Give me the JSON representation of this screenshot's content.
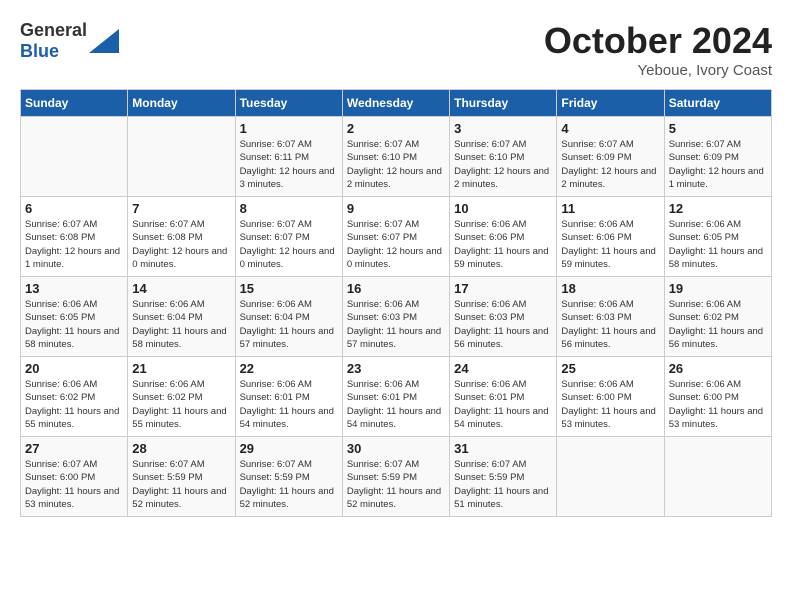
{
  "header": {
    "logo_general": "General",
    "logo_blue": "Blue",
    "month": "October 2024",
    "location": "Yeboue, Ivory Coast"
  },
  "weekdays": [
    "Sunday",
    "Monday",
    "Tuesday",
    "Wednesday",
    "Thursday",
    "Friday",
    "Saturday"
  ],
  "weeks": [
    [
      {
        "day": "",
        "content": ""
      },
      {
        "day": "",
        "content": ""
      },
      {
        "day": "1",
        "content": "Sunrise: 6:07 AM\nSunset: 6:11 PM\nDaylight: 12 hours and 3 minutes."
      },
      {
        "day": "2",
        "content": "Sunrise: 6:07 AM\nSunset: 6:10 PM\nDaylight: 12 hours and 2 minutes."
      },
      {
        "day": "3",
        "content": "Sunrise: 6:07 AM\nSunset: 6:10 PM\nDaylight: 12 hours and 2 minutes."
      },
      {
        "day": "4",
        "content": "Sunrise: 6:07 AM\nSunset: 6:09 PM\nDaylight: 12 hours and 2 minutes."
      },
      {
        "day": "5",
        "content": "Sunrise: 6:07 AM\nSunset: 6:09 PM\nDaylight: 12 hours and 1 minute."
      }
    ],
    [
      {
        "day": "6",
        "content": "Sunrise: 6:07 AM\nSunset: 6:08 PM\nDaylight: 12 hours and 1 minute."
      },
      {
        "day": "7",
        "content": "Sunrise: 6:07 AM\nSunset: 6:08 PM\nDaylight: 12 hours and 0 minutes."
      },
      {
        "day": "8",
        "content": "Sunrise: 6:07 AM\nSunset: 6:07 PM\nDaylight: 12 hours and 0 minutes."
      },
      {
        "day": "9",
        "content": "Sunrise: 6:07 AM\nSunset: 6:07 PM\nDaylight: 12 hours and 0 minutes."
      },
      {
        "day": "10",
        "content": "Sunrise: 6:06 AM\nSunset: 6:06 PM\nDaylight: 11 hours and 59 minutes."
      },
      {
        "day": "11",
        "content": "Sunrise: 6:06 AM\nSunset: 6:06 PM\nDaylight: 11 hours and 59 minutes."
      },
      {
        "day": "12",
        "content": "Sunrise: 6:06 AM\nSunset: 6:05 PM\nDaylight: 11 hours and 58 minutes."
      }
    ],
    [
      {
        "day": "13",
        "content": "Sunrise: 6:06 AM\nSunset: 6:05 PM\nDaylight: 11 hours and 58 minutes."
      },
      {
        "day": "14",
        "content": "Sunrise: 6:06 AM\nSunset: 6:04 PM\nDaylight: 11 hours and 58 minutes."
      },
      {
        "day": "15",
        "content": "Sunrise: 6:06 AM\nSunset: 6:04 PM\nDaylight: 11 hours and 57 minutes."
      },
      {
        "day": "16",
        "content": "Sunrise: 6:06 AM\nSunset: 6:03 PM\nDaylight: 11 hours and 57 minutes."
      },
      {
        "day": "17",
        "content": "Sunrise: 6:06 AM\nSunset: 6:03 PM\nDaylight: 11 hours and 56 minutes."
      },
      {
        "day": "18",
        "content": "Sunrise: 6:06 AM\nSunset: 6:03 PM\nDaylight: 11 hours and 56 minutes."
      },
      {
        "day": "19",
        "content": "Sunrise: 6:06 AM\nSunset: 6:02 PM\nDaylight: 11 hours and 56 minutes."
      }
    ],
    [
      {
        "day": "20",
        "content": "Sunrise: 6:06 AM\nSunset: 6:02 PM\nDaylight: 11 hours and 55 minutes."
      },
      {
        "day": "21",
        "content": "Sunrise: 6:06 AM\nSunset: 6:02 PM\nDaylight: 11 hours and 55 minutes."
      },
      {
        "day": "22",
        "content": "Sunrise: 6:06 AM\nSunset: 6:01 PM\nDaylight: 11 hours and 54 minutes."
      },
      {
        "day": "23",
        "content": "Sunrise: 6:06 AM\nSunset: 6:01 PM\nDaylight: 11 hours and 54 minutes."
      },
      {
        "day": "24",
        "content": "Sunrise: 6:06 AM\nSunset: 6:01 PM\nDaylight: 11 hours and 54 minutes."
      },
      {
        "day": "25",
        "content": "Sunrise: 6:06 AM\nSunset: 6:00 PM\nDaylight: 11 hours and 53 minutes."
      },
      {
        "day": "26",
        "content": "Sunrise: 6:06 AM\nSunset: 6:00 PM\nDaylight: 11 hours and 53 minutes."
      }
    ],
    [
      {
        "day": "27",
        "content": "Sunrise: 6:07 AM\nSunset: 6:00 PM\nDaylight: 11 hours and 53 minutes."
      },
      {
        "day": "28",
        "content": "Sunrise: 6:07 AM\nSunset: 5:59 PM\nDaylight: 11 hours and 52 minutes."
      },
      {
        "day": "29",
        "content": "Sunrise: 6:07 AM\nSunset: 5:59 PM\nDaylight: 11 hours and 52 minutes."
      },
      {
        "day": "30",
        "content": "Sunrise: 6:07 AM\nSunset: 5:59 PM\nDaylight: 11 hours and 52 minutes."
      },
      {
        "day": "31",
        "content": "Sunrise: 6:07 AM\nSunset: 5:59 PM\nDaylight: 11 hours and 51 minutes."
      },
      {
        "day": "",
        "content": ""
      },
      {
        "day": "",
        "content": ""
      }
    ]
  ]
}
